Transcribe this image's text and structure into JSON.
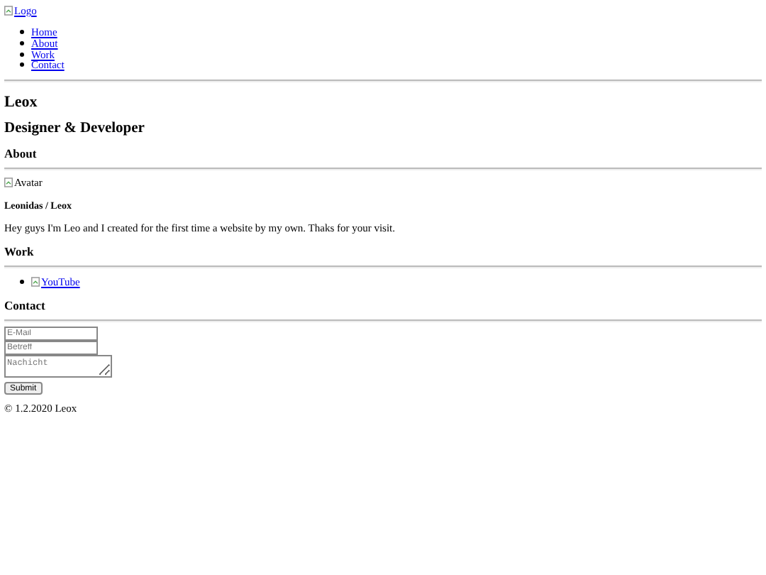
{
  "logo": {
    "alt": "Logo"
  },
  "nav": [
    {
      "label": "Home"
    },
    {
      "label": "About"
    },
    {
      "label": "Work"
    },
    {
      "label": "Contact"
    }
  ],
  "title": "Leox",
  "subtitle": "Designer & Developer",
  "about": {
    "heading": "About",
    "avatar_alt": "Avatar",
    "name": "Leonidas / Leox",
    "text": "Hey guys I'm Leo and I created for the first time a website by my own. Thaks for your visit."
  },
  "work": {
    "heading": "Work",
    "links": [
      {
        "alt": "YouTube"
      }
    ]
  },
  "contact": {
    "heading": "Contact",
    "email_placeholder": "E-Mail",
    "subject_placeholder": "Betreff",
    "message_placeholder": "Nachicht",
    "submit": "Submit"
  },
  "footer": "© 1.2.2020 Leox"
}
